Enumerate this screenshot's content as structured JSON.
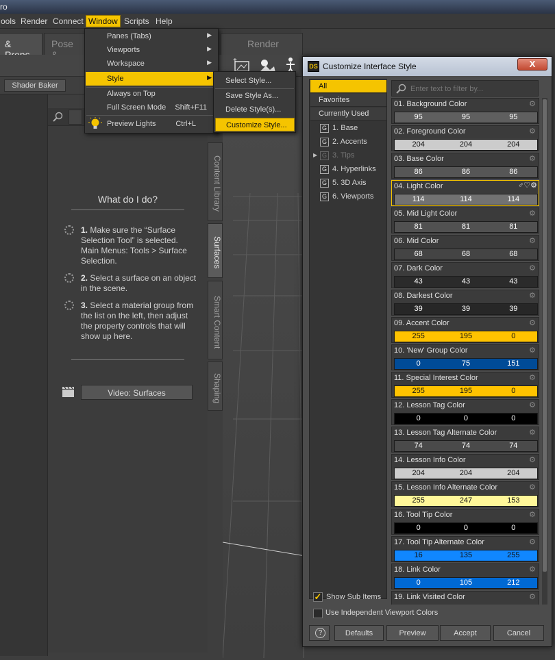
{
  "window_title": "ro",
  "menubar": {
    "items": [
      "ools",
      "Render",
      "Connect",
      "Window",
      "Scripts",
      "Help"
    ],
    "active": "Window"
  },
  "tabs": [
    "& Props",
    "Pose &",
    "Render"
  ],
  "subtoolbar": {
    "shader_baker": "Shader Baker"
  },
  "window_menu": {
    "items": [
      {
        "label": "Panes (Tabs)",
        "submenu": true
      },
      {
        "label": "Viewports",
        "submenu": true
      },
      {
        "label": "Workspace",
        "submenu": true
      },
      {
        "label": "Style",
        "submenu": true,
        "highlighted": true
      },
      {
        "label": "Always on Top"
      },
      {
        "label": "Full Screen Mode",
        "shortcut": "Shift+F11"
      },
      {
        "label": "Preview Lights",
        "shortcut": "Ctrl+L",
        "icon": "lightbulb-icon"
      }
    ]
  },
  "style_submenu": {
    "items": [
      "Select Style...",
      "Save Style As...",
      "Delete Style(s)...",
      "Customize Style..."
    ],
    "highlighted": "Customize Style..."
  },
  "surfaces_help": {
    "title": "What do I do?",
    "steps": [
      {
        "num": "1.",
        "text": "Make sure the “Surface Selection Tool” is selected. Main Menus: Tools > Surface Selection."
      },
      {
        "num": "2.",
        "text": "Select a surface on an object in the scene."
      },
      {
        "num": "3.",
        "text": "Select a material group from the list on the left, then adjust the property controls that will show up here."
      }
    ],
    "video_button": "Video: Surfaces"
  },
  "side_tabs": [
    "Content Library",
    "Surfaces",
    "Smart Content",
    "Shaping"
  ],
  "dialog": {
    "title": "Customize Interface Style",
    "logo": "DS",
    "close": "X",
    "categories": [
      "All",
      "Favorites",
      "Currently Used"
    ],
    "groups": [
      {
        "label": "1. Base"
      },
      {
        "label": "2. Accents"
      },
      {
        "label": "3. Tips",
        "dim": true,
        "expand": true
      },
      {
        "label": "4. Hyperlinks"
      },
      {
        "label": "5. 3D Axis"
      },
      {
        "label": "6. Viewports"
      }
    ],
    "filter_placeholder": "Enter text to filter by...",
    "properties": [
      {
        "label": "01. Background Color",
        "rgb": [
          95,
          95,
          95
        ],
        "bg": "#5f5f5f",
        "fg": "#ffffff"
      },
      {
        "label": "02. Foreground Color",
        "rgb": [
          204,
          204,
          204
        ],
        "bg": "#cccccc",
        "fg": "#111111"
      },
      {
        "label": "03. Base Color",
        "rgb": [
          86,
          86,
          86
        ],
        "bg": "#565656",
        "fg": "#ffffff"
      },
      {
        "label": "04. Light Color",
        "rgb": [
          114,
          114,
          114
        ],
        "bg": "#727272",
        "fg": "#ffffff",
        "selected": true
      },
      {
        "label": "05. Mid Light Color",
        "rgb": [
          81,
          81,
          81
        ],
        "bg": "#515151",
        "fg": "#ffffff"
      },
      {
        "label": "06. Mid Color",
        "rgb": [
          68,
          68,
          68
        ],
        "bg": "#444444",
        "fg": "#ffffff"
      },
      {
        "label": "07. Dark Color",
        "rgb": [
          43,
          43,
          43
        ],
        "bg": "#2b2b2b",
        "fg": "#ffffff"
      },
      {
        "label": "08. Darkest Color",
        "rgb": [
          39,
          39,
          39
        ],
        "bg": "#272727",
        "fg": "#ffffff"
      },
      {
        "label": "09. Accent Color",
        "rgb": [
          255,
          195,
          0
        ],
        "bg": "#ffc300",
        "fg": "#111111"
      },
      {
        "label": "10. 'New' Group Color",
        "rgb": [
          0,
          75,
          151
        ],
        "bg": "#004b97",
        "fg": "#ffffff"
      },
      {
        "label": "11. Special Interest Color",
        "rgb": [
          255,
          195,
          0
        ],
        "bg": "#ffc300",
        "fg": "#111111"
      },
      {
        "label": "12. Lesson Tag Color",
        "rgb": [
          0,
          0,
          0
        ],
        "bg": "#000000",
        "fg": "#ffffff"
      },
      {
        "label": "13. Lesson Tag Alternate Color",
        "rgb": [
          74,
          74,
          74
        ],
        "bg": "#4a4a4a",
        "fg": "#ffffff"
      },
      {
        "label": "14. Lesson Info Color",
        "rgb": [
          204,
          204,
          204
        ],
        "bg": "#cccccc",
        "fg": "#111111"
      },
      {
        "label": "15. Lesson Info Alternate Color",
        "rgb": [
          255,
          247,
          153
        ],
        "bg": "#fff799",
        "fg": "#111111"
      },
      {
        "label": "16. Tool Tip Color",
        "rgb": [
          0,
          0,
          0
        ],
        "bg": "#000000",
        "fg": "#ffffff"
      },
      {
        "label": "17. Tool Tip Alternate Color",
        "rgb": [
          16,
          135,
          255
        ],
        "bg": "#1087ff",
        "fg": "#111111"
      },
      {
        "label": "18. Link Color",
        "rgb": [
          0,
          105,
          212
        ],
        "bg": "#0069d4",
        "fg": "#ffffff"
      },
      {
        "label": "19. Link Visited Color",
        "rgb": [],
        "bg": "#7a7a7a",
        "fg": "#ffffff"
      }
    ],
    "show_sub_items": "Show Sub Items",
    "independent_viewport": "Use Independent Viewport Colors",
    "buttons": [
      "Defaults",
      "Preview",
      "Accept",
      "Cancel"
    ],
    "help": "?"
  },
  "colors": {
    "accent": "#f5c400",
    "panel": "#3c3c3c",
    "dialog": "#4c4c4c"
  }
}
